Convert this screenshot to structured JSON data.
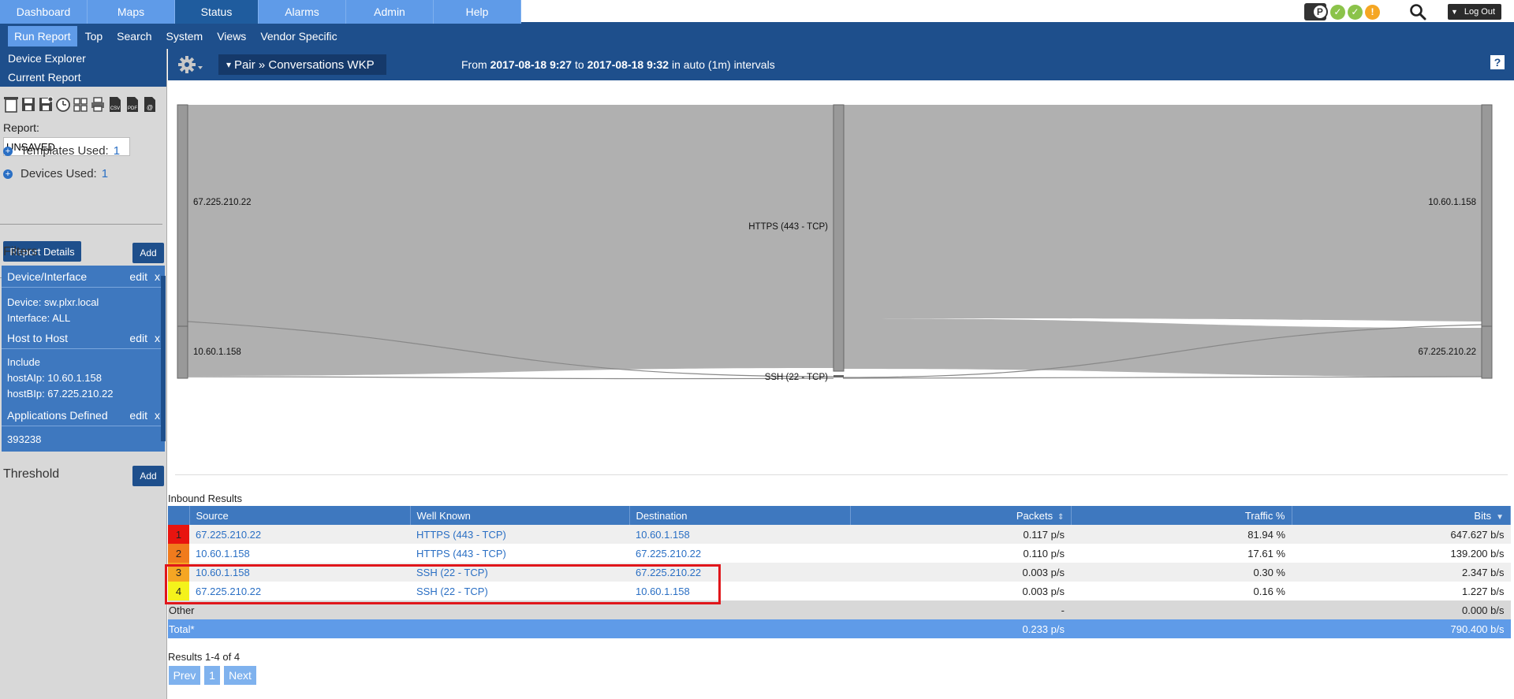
{
  "topnav": {
    "tabs": [
      "Dashboard",
      "Maps",
      "Status",
      "Alarms",
      "Admin",
      "Help"
    ],
    "active_tab": "Status",
    "server_badge": "P",
    "status_icons": [
      "✓",
      "✓",
      "!"
    ],
    "logout": "Log Out"
  },
  "subnav": {
    "items": [
      "Run Report",
      "Top",
      "Search",
      "System",
      "Views",
      "Vendor Specific"
    ],
    "active": "Run Report"
  },
  "sidebar": {
    "device_explorer": "Device Explorer",
    "current_report": "Current Report",
    "report_label": "Report:",
    "report_value": "UNSAVED",
    "templates_label": "Templates Used:",
    "templates_count": "1",
    "devices_label": "Devices Used:",
    "devices_count": "1",
    "report_details": "Report Details",
    "filters_title": "Filters",
    "add": "Add",
    "edit": "edit",
    "x": "x",
    "filters": [
      {
        "title": "Device/Interface",
        "lines": [
          "Device: sw.plxr.local",
          "Interface: ALL"
        ]
      },
      {
        "title": "Host to Host",
        "lines": [
          "Include",
          "hostAIp: 10.60.1.158",
          "hostBIp: 67.225.210.22"
        ]
      },
      {
        "title": "Applications Defined",
        "lines": [
          "393238"
        ]
      }
    ],
    "threshold_title": "Threshold"
  },
  "mainbar": {
    "pair_prefix": "▾",
    "pair_label": "Pair » Conversations WKP",
    "range_from_label": "From",
    "range_from": "2017-08-18 9:27",
    "range_to_label": "to",
    "range_to": "2017-08-18 9:32",
    "range_suffix": "in auto (1m) intervals",
    "help": "?"
  },
  "sankey": {
    "left_nodes": [
      "67.225.210.22",
      "10.60.1.158"
    ],
    "middle_nodes": [
      "HTTPS (443 - TCP)",
      "SSH (22 - TCP)"
    ],
    "right_nodes": [
      "10.60.1.158",
      "67.225.210.22"
    ],
    "colors": {
      "node": "#999999",
      "flow": "#b0b0b0"
    }
  },
  "table": {
    "title": "Inbound Results",
    "headers": {
      "source": "Source",
      "well_known": "Well Known",
      "destination": "Destination",
      "packets": "Packets",
      "traffic": "Traffic %",
      "bits": "Bits"
    },
    "rows": [
      {
        "rank": "1",
        "color": "#e8140f",
        "source": "67.225.210.22",
        "wk": "HTTPS (443 - TCP)",
        "dest": "10.60.1.158",
        "packets": "0.117 p/s",
        "traffic": "81.94 %",
        "bits": "647.627 b/s"
      },
      {
        "rank": "2",
        "color": "#f07b1d",
        "source": "10.60.1.158",
        "wk": "HTTPS (443 - TCP)",
        "dest": "67.225.210.22",
        "packets": "0.110 p/s",
        "traffic": "17.61 %",
        "bits": "139.200 b/s"
      },
      {
        "rank": "3",
        "color": "#f5a623",
        "source": "10.60.1.158",
        "wk": "SSH (22 - TCP)",
        "dest": "67.225.210.22",
        "packets": "0.003 p/s",
        "traffic": "0.30 %",
        "bits": "2.347 b/s"
      },
      {
        "rank": "4",
        "color": "#f4f21b",
        "source": "67.225.210.22",
        "wk": "SSH (22 - TCP)",
        "dest": "10.60.1.158",
        "packets": "0.003 p/s",
        "traffic": "0.16 %",
        "bits": "1.227 b/s"
      }
    ],
    "other": {
      "label": "Other",
      "packets": "-",
      "bits": "0.000 b/s"
    },
    "total": {
      "label": "Total*",
      "packets": "0.233 p/s",
      "bits": "790.400 b/s"
    }
  },
  "pagination": {
    "count": "Results 1-4 of 4",
    "prev": "Prev",
    "page": "1",
    "next": "Next"
  }
}
